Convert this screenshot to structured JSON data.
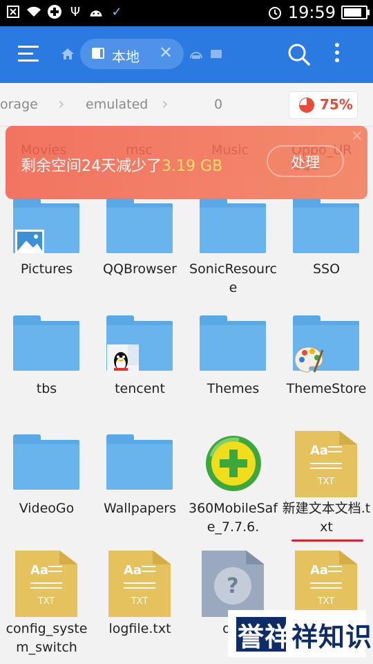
{
  "status_bar": {
    "time": "19:59",
    "left_icons": [
      "close-box-icon",
      "wifi-icon",
      "360-security-icon",
      "usb-icon",
      "android-icon",
      "check-icon"
    ],
    "right_icons": [
      "alarm-icon",
      "battery-icon"
    ],
    "battery_level": 0.95
  },
  "title_bar": {
    "tab_label": "本地",
    "menu_icon": "hamburger-icon",
    "home_icon": "home-icon",
    "search_icon": "search-icon",
    "more_icon": "more-vertical-icon"
  },
  "breadcrumb": {
    "items": [
      "orage",
      "emulated",
      "0"
    ],
    "usage_percent_label": "75%",
    "usage_fraction": 0.75
  },
  "banner": {
    "message_prefix": "剩余空间24天减少了",
    "message_highlight": "3.19 GB",
    "action_label": "处理",
    "close_symbol": "×",
    "ghost_labels": [
      "Movies",
      "msc",
      "Music",
      "Oppo_UR CQS"
    ]
  },
  "files": [
    {
      "name": "Pictures",
      "type": "folder",
      "badge": "picture-icon"
    },
    {
      "name": "QQBrowser",
      "type": "folder"
    },
    {
      "name": "SonicResource",
      "type": "folder"
    },
    {
      "name": "SSO",
      "type": "folder"
    },
    {
      "name": "tbs",
      "type": "folder"
    },
    {
      "name": "tencent",
      "type": "folder",
      "badge": "qq-penguin-icon"
    },
    {
      "name": "Themes",
      "type": "folder"
    },
    {
      "name": "ThemeStore",
      "type": "folder",
      "badge": "palette-icon"
    },
    {
      "name": "VideoGo",
      "type": "folder"
    },
    {
      "name": "Wallpapers",
      "type": "folder"
    },
    {
      "name": "360MobileSafe_7.7.6.",
      "type": "app",
      "badge": "360-plus-icon"
    },
    {
      "name": "新建文本文档.txt",
      "type": "txt",
      "ext": "TXT"
    },
    {
      "name": "config_system_switch",
      "type": "txt",
      "ext": "TXT"
    },
    {
      "name": "logfile.txt",
      "type": "txt",
      "ext": "TXT"
    },
    {
      "name": "ota",
      "type": "unknown",
      "badge": "question-icon"
    },
    {
      "name": "",
      "type": "txt",
      "ext": "TXT"
    }
  ],
  "txt_icon_label": "Aa",
  "watermark": {
    "text_1": "誉",
    "text_2": "祥",
    "text_3": "祥知识"
  },
  "colors": {
    "title_bar": "#2a7ae2",
    "folder": "#5aa9e6",
    "txt": "#e6c25e",
    "banner": "#f26f5b",
    "accent_red": "#e84a3c"
  }
}
